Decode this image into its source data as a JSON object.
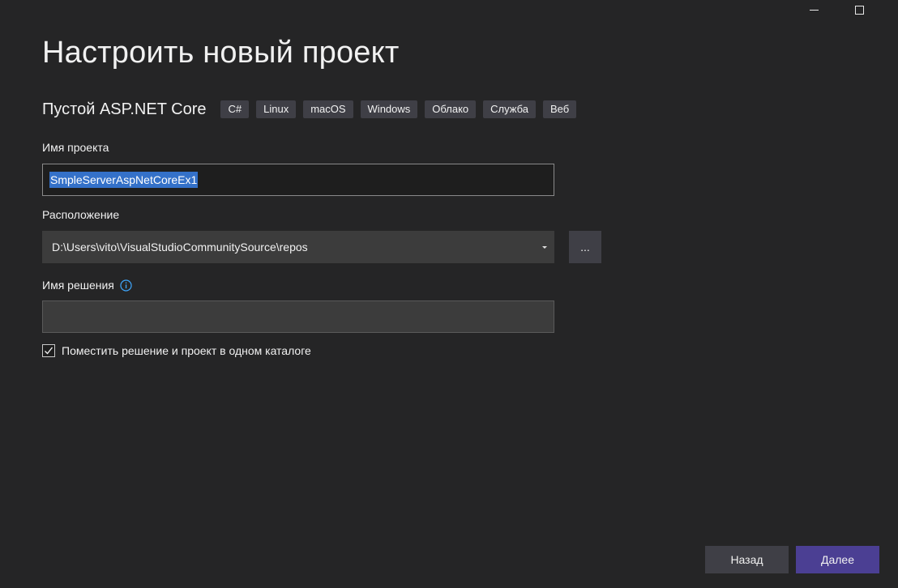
{
  "window": {
    "minimize_label": "Minimize",
    "maximize_label": "Maximize"
  },
  "page": {
    "title": "Настроить новый проект"
  },
  "template": {
    "name": "Пустой ASP.NET Core",
    "tags": [
      "C#",
      "Linux",
      "macOS",
      "Windows",
      "Облако",
      "Служба",
      "Веб"
    ]
  },
  "project_name": {
    "label": "Имя проекта",
    "value": "SmpleServerAspNetCoreEx1"
  },
  "location": {
    "label": "Расположение",
    "value": "D:\\Users\\vito\\VisualStudioCommunitySource\\repos",
    "browse_label": "..."
  },
  "solution_name": {
    "label": "Имя решения",
    "value": "",
    "info_icon": "info-icon"
  },
  "same_dir_checkbox": {
    "label": "Поместить решение и проект в одном каталоге",
    "checked": true
  },
  "footer": {
    "back_label": "Назад",
    "next_label": "Далее"
  },
  "colors": {
    "background": "#252526",
    "accent": "#4b3f93",
    "selection": "#3471c9",
    "info_icon": "#3fa8ff"
  }
}
